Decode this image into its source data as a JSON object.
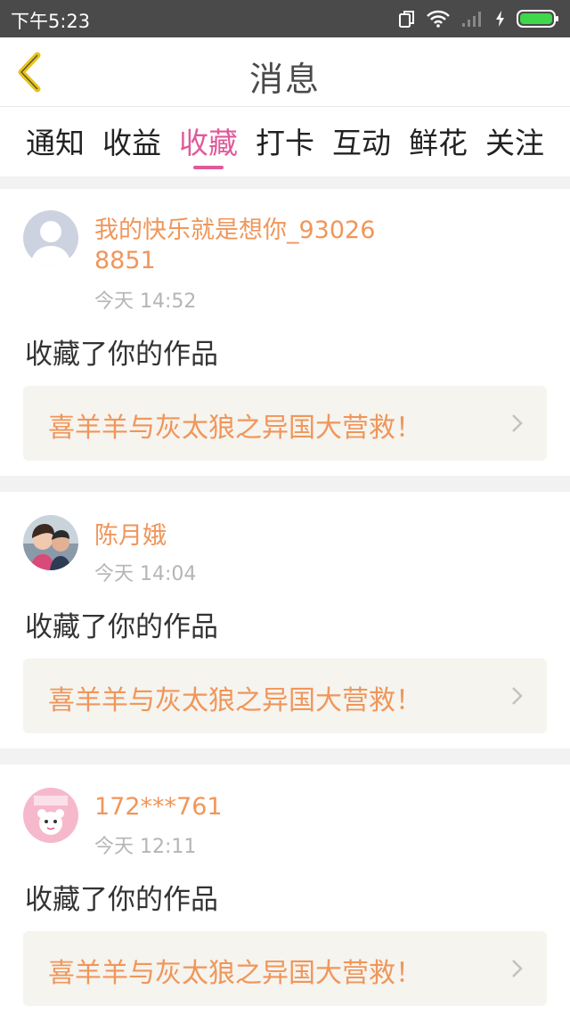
{
  "statusbar": {
    "time": "下午5:23"
  },
  "header": {
    "title": "消息"
  },
  "tabs": [
    {
      "label": "通知"
    },
    {
      "label": "收益"
    },
    {
      "label": "收藏",
      "active": true
    },
    {
      "label": "打卡"
    },
    {
      "label": "互动"
    },
    {
      "label": "鲜花"
    },
    {
      "label": "关注"
    }
  ],
  "messages": [
    {
      "username": "我的快乐就是想你_930268851",
      "time": "今天 14:52",
      "action": "收藏了你的作品",
      "work_title": "喜羊羊与灰太狼之异国大营救！"
    },
    {
      "username": "陈月娥",
      "time": "今天 14:04",
      "action": "收藏了你的作品",
      "work_title": "喜羊羊与灰太狼之异国大营救！"
    },
    {
      "username": "172***761",
      "time": "今天 12:11",
      "action": "收藏了你的作品",
      "work_title": "喜羊羊与灰太狼之异国大营救！"
    }
  ],
  "colors": {
    "accent": "#e05a9a",
    "link": "#f0965a",
    "statusbar": "#4a4a4a"
  }
}
